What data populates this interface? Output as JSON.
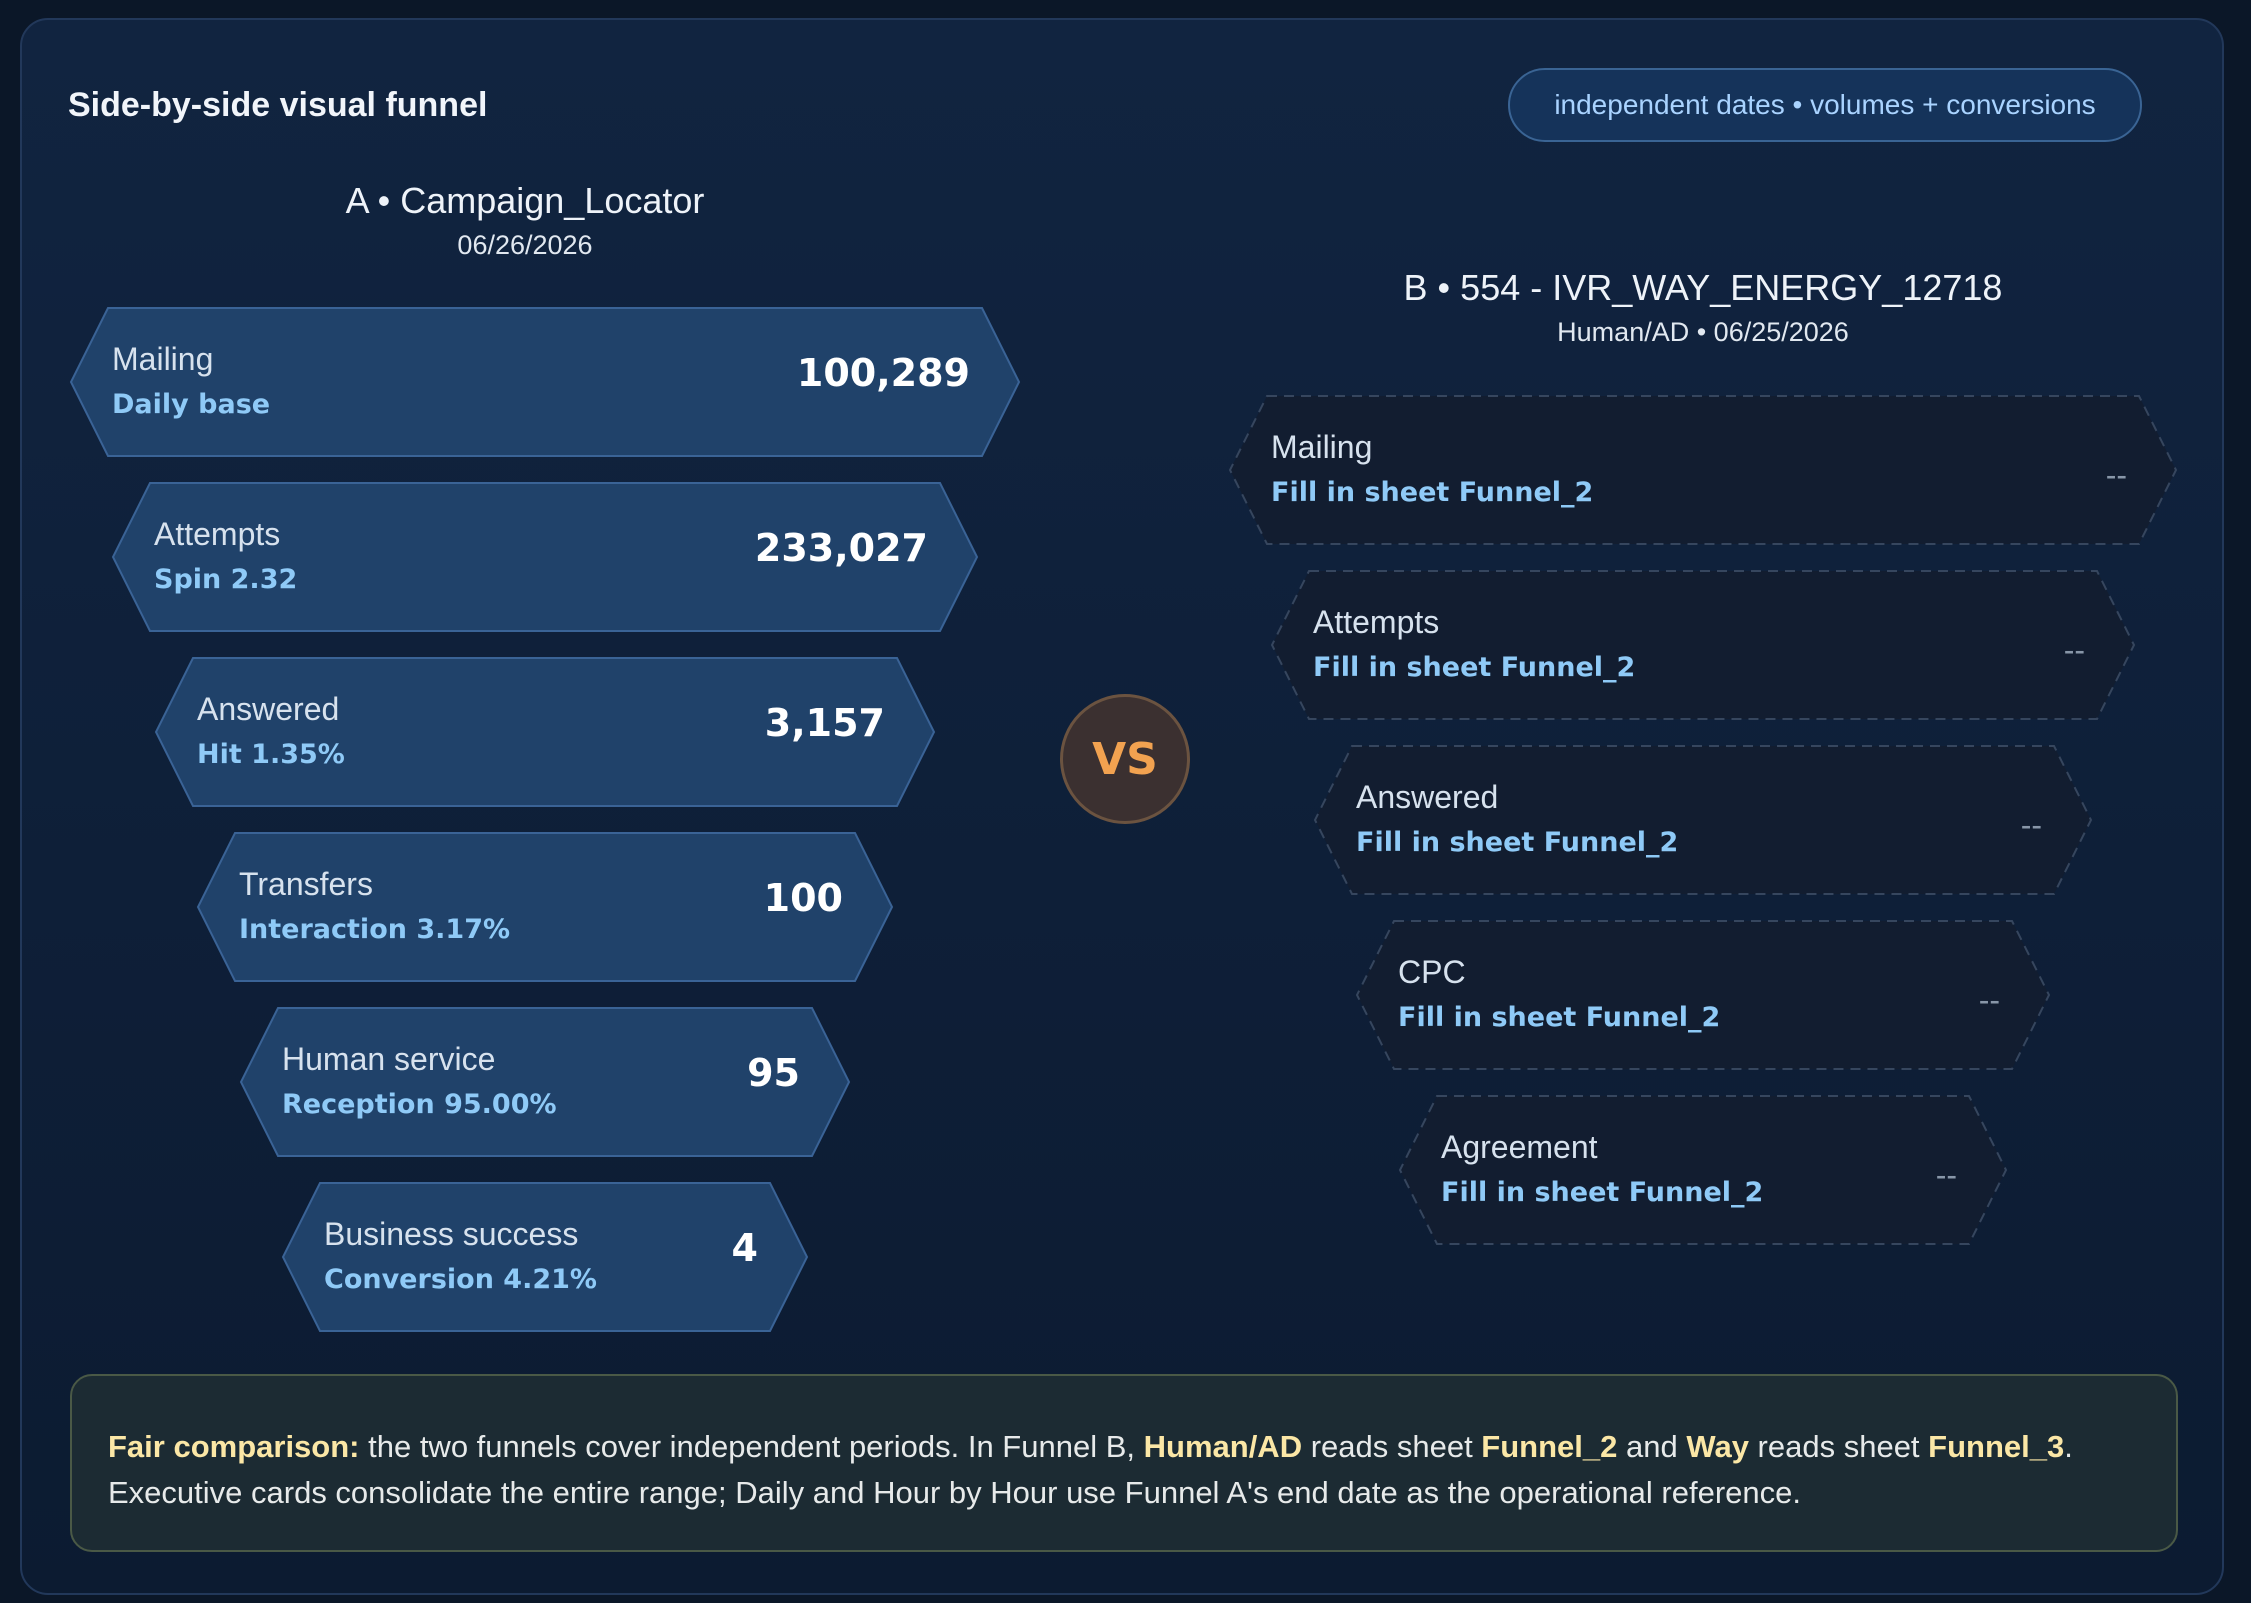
{
  "title": "Side-by-side visual funnel",
  "badge": "independent dates • volumes + conversions",
  "vs_label": "VS",
  "colors": {
    "background": "#0b1728",
    "stage_fill": "#1f4066",
    "stage_border": "#34598a",
    "sub_text": "#8fcaf7",
    "vs_text": "#f2a250",
    "note_highlight": "#fbe7a6"
  },
  "funnel_a": {
    "name": "A • Campaign_Locator",
    "date": "06/26/2026",
    "stages": [
      {
        "label": "Mailing",
        "sub": "Daily base",
        "value": "100,289"
      },
      {
        "label": "Attempts",
        "sub": "Spin 2.32",
        "value": "233,027"
      },
      {
        "label": "Answered",
        "sub": "Hit 1.35%",
        "value": "3,157"
      },
      {
        "label": "Transfers",
        "sub": "Interaction 3.17%",
        "value": "100"
      },
      {
        "label": "Human service",
        "sub": "Reception 95.00%",
        "value": "95"
      },
      {
        "label": "Business success",
        "sub": "Conversion 4.21%",
        "value": "4"
      }
    ]
  },
  "funnel_b": {
    "name": "B • 554 - IVR_WAY_ENERGY_12718",
    "date": "Human/AD • 06/25/2026",
    "stages": [
      {
        "label": "Mailing",
        "sub": "Fill in sheet Funnel_2",
        "value": "--"
      },
      {
        "label": "Attempts",
        "sub": "Fill in sheet Funnel_2",
        "value": "--"
      },
      {
        "label": "Answered",
        "sub": "Fill in sheet Funnel_2",
        "value": "--"
      },
      {
        "label": "CPC",
        "sub": "Fill in sheet Funnel_2",
        "value": "--"
      },
      {
        "label": "Agreement",
        "sub": "Fill in sheet Funnel_2",
        "value": "--"
      }
    ]
  },
  "note": {
    "lead": "Fair comparison:",
    "t1": " the two funnels cover independent periods. In Funnel B, ",
    "k1": "Human/AD",
    "t2": " reads sheet ",
    "k2": "Funnel_2",
    "t3": " and ",
    "k3": "Way",
    "t4": " reads sheet ",
    "k4": "Funnel_3",
    "t5": ". Executive cards consolidate the entire range; Daily and Hour by Hour use Funnel A's end date as the operational reference."
  }
}
